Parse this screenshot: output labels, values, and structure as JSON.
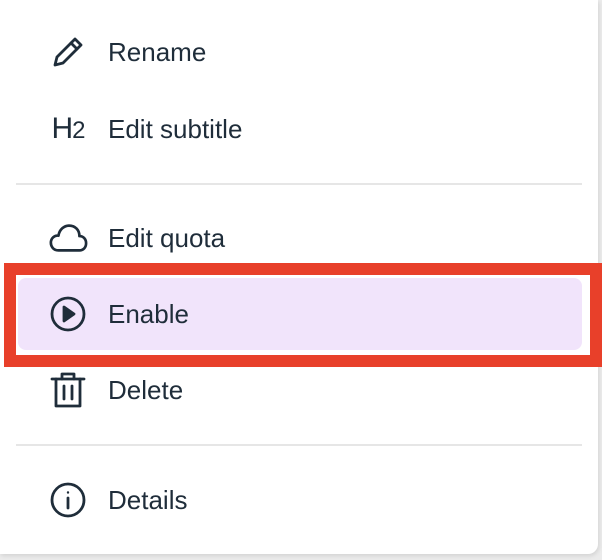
{
  "menu": {
    "items": [
      {
        "label": "Rename",
        "icon": "pencil-icon"
      },
      {
        "label": "Edit subtitle",
        "icon": "heading-h2-icon",
        "icon_text_h": "H",
        "icon_text_2": "2"
      },
      {
        "label": "Edit quota",
        "icon": "cloud-icon"
      },
      {
        "label": "Enable",
        "icon": "play-circle-icon",
        "selected": true
      },
      {
        "label": "Delete",
        "icon": "trash-icon"
      },
      {
        "label": "Details",
        "icon": "info-circle-icon"
      }
    ]
  },
  "colors": {
    "text": "#1f2d3a",
    "selected_background": "#f1e4fb",
    "highlight_border": "#e8402a",
    "divider": "#e6e6e6"
  }
}
